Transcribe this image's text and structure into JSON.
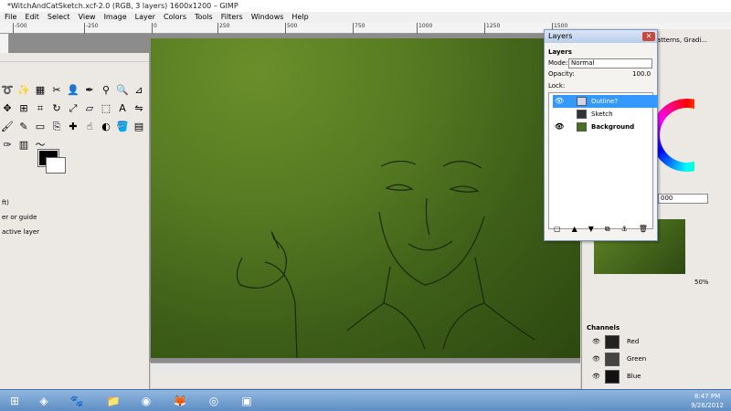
{
  "window": {
    "title": "*WitchAndCatSketch.xcf-2.0 (RGB, 3 layers) 1600x1200 – GIMP"
  },
  "menu": [
    "File",
    "Edit",
    "Select",
    "View",
    "Image",
    "Layer",
    "Colors",
    "Tools",
    "Filters",
    "Windows",
    "Help"
  ],
  "ruler": [
    "-500",
    "-250",
    "0",
    "250",
    "500",
    "750",
    "1000",
    "1250",
    "1500"
  ],
  "toolbox": {
    "options": [
      "ft)",
      "er or guide",
      "active layer"
    ]
  },
  "layers_dialog": {
    "title": "Layers",
    "subtitle": "Layers",
    "mode_label": "Mode:",
    "mode_value": "Normal",
    "opacity_label": "Opacity:",
    "opacity_value": "100.0",
    "lock_label": "Lock:",
    "layers": [
      {
        "name": "Outline?",
        "visible": true,
        "selected": true
      },
      {
        "name": "Sketch",
        "visible": false,
        "selected": false
      },
      {
        "name": "Background",
        "visible": true,
        "selected": false
      }
    ]
  },
  "right_dock": {
    "tab_label": "Patterns, Gradi...",
    "hex_value": "000",
    "zoom": "50%",
    "channels_title": "Channels",
    "channels": [
      {
        "name": "Red"
      },
      {
        "name": "Green"
      },
      {
        "name": "Blue"
      }
    ]
  },
  "taskbar": {
    "time": "8:47 PM",
    "date": "9/26/2012"
  },
  "colors": {
    "accent": "#3399ff",
    "canvas": "#4a6f1e",
    "titlebar": "#b8cde9"
  }
}
